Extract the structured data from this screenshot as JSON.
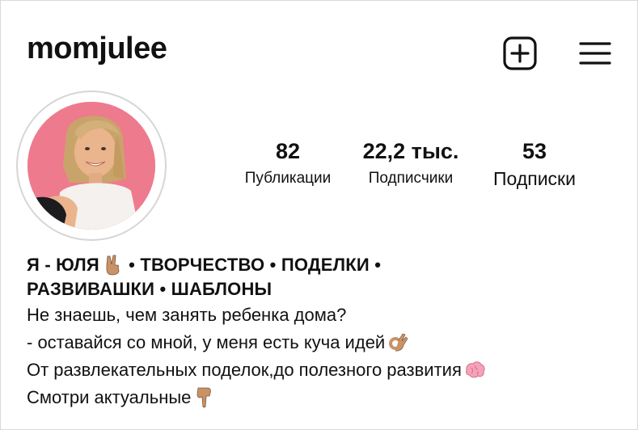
{
  "profile": {
    "username": "momjulee"
  },
  "header": {
    "icons": [
      "plus-square-icon",
      "hamburger-menu-icon"
    ]
  },
  "stats": {
    "posts_count": "82",
    "posts_label": "Публикации",
    "followers_count": "22,2 тыс.",
    "followers_label": "Подписчики",
    "following_count": "53",
    "following_label": "Подписки"
  },
  "bio": {
    "title_line1_a": "Я - ЮЛЯ",
    "title_line1_b": " • ТВОРЧЕСТВО • ПОДЕЛКИ •",
    "title_line2": "РАЗВИВАШКИ • ШАБЛОНЫ",
    "line1": "Не знаешь, чем занять ребенка дома?",
    "line2": "- оставайся со мной, у меня есть куча идей",
    "line3": "От развлекательных поделок,до полезного развития",
    "line4": "Смотри актуальные",
    "emoji_names": [
      "victory-hand-icon",
      "ok-hand-icon",
      "brain-icon",
      "pointing-down-icon"
    ]
  },
  "colors": {
    "avatar_background": "#f07d92",
    "avatar_ring": "#d6d6d6",
    "text": "#111111",
    "skin_emoji": "#c99368"
  }
}
